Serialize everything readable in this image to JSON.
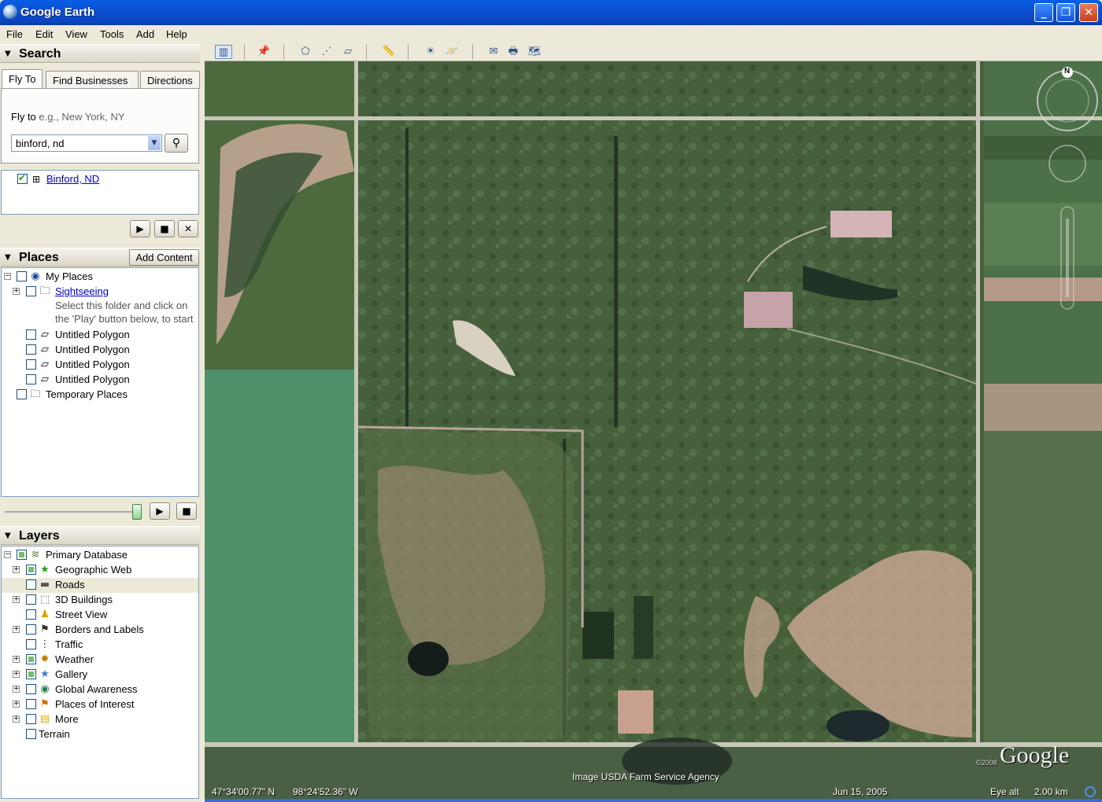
{
  "window": {
    "title": "Google Earth"
  },
  "menu": [
    "File",
    "Edit",
    "View",
    "Tools",
    "Add",
    "Help"
  ],
  "search": {
    "header": "Search",
    "tabs": [
      "Fly To",
      "Find Businesses",
      "Directions"
    ],
    "fly_to_label": "Fly to",
    "fly_to_hint": "e.g., New York, NY",
    "query": "binford, nd",
    "result": "Binford, ND"
  },
  "places": {
    "header": "Places",
    "add_content": "Add Content",
    "my_places": "My Places",
    "sightseeing": "Sightseeing",
    "hint_line1": "Select this folder and click on",
    "hint_line2": "the 'Play' button below, to start",
    "polygons": [
      "Untitled Polygon",
      "Untitled Polygon",
      "Untitled Polygon",
      "Untitled Polygon"
    ],
    "temporary": "Temporary Places"
  },
  "layers": {
    "header": "Layers",
    "items": [
      "Primary Database",
      "Geographic Web",
      "Roads",
      "3D Buildings",
      "Street View",
      "Borders and Labels",
      "Traffic",
      "Weather",
      "Gallery",
      "Global Awareness",
      "Places of Interest",
      "More",
      "Terrain"
    ]
  },
  "map": {
    "compass": "N",
    "attribution": "Image USDA Farm Service Agency",
    "lat": "47°34'00.77\" N",
    "lon": "98°24'52.36\" W",
    "date": "Jun 15, 2005",
    "eye_alt_label": "Eye alt",
    "eye_alt": "2.00 km",
    "logo": "Google",
    "copyright": "©2008"
  },
  "colors": {
    "titlebar": "#0a4fd1",
    "field_green": "#4f8f6a",
    "road": "#c9c8b8"
  }
}
